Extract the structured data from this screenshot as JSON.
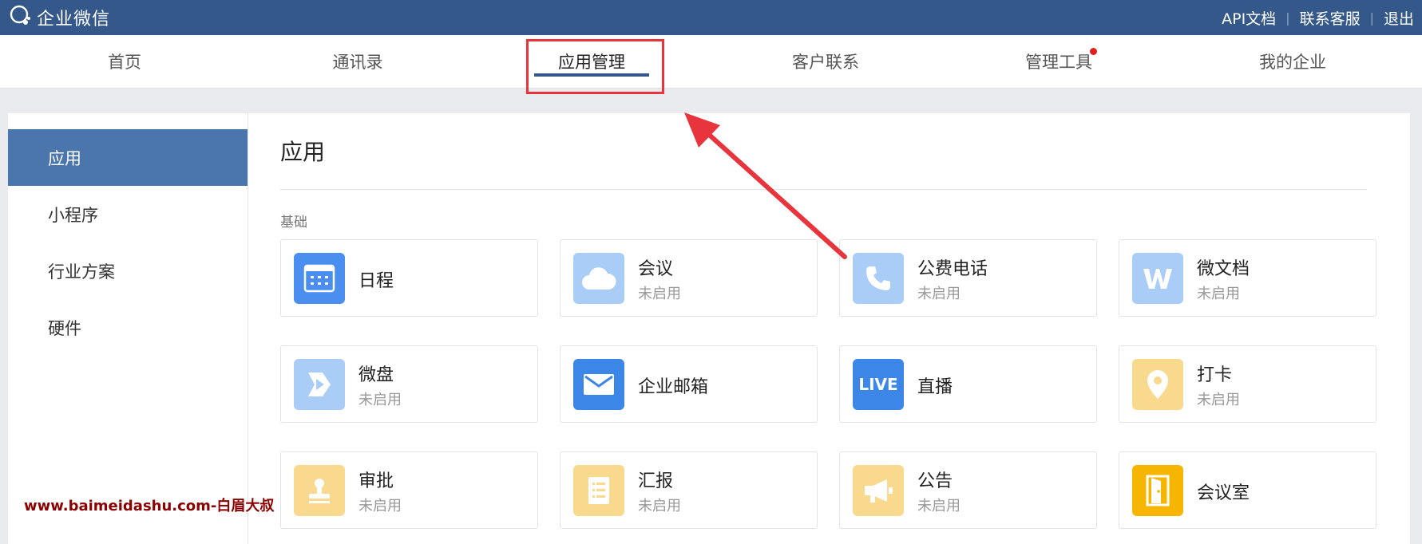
{
  "topbar": {
    "logo_text": "企业微信",
    "links": [
      "API文档",
      "联系客服",
      "退出"
    ]
  },
  "nav": {
    "tabs": [
      {
        "label": "首页"
      },
      {
        "label": "通讯录"
      },
      {
        "label": "应用管理",
        "active": true
      },
      {
        "label": "客户联系"
      },
      {
        "label": "管理工具",
        "badge": true
      },
      {
        "label": "我的企业"
      }
    ]
  },
  "sidebar": {
    "items": [
      {
        "label": "应用",
        "active": true
      },
      {
        "label": "小程序"
      },
      {
        "label": "行业方案"
      },
      {
        "label": "硬件"
      }
    ]
  },
  "main": {
    "title": "应用",
    "section": "基础",
    "apps": [
      {
        "name": "日程",
        "status": "",
        "icon": "calendar-icon",
        "color": "#4a8eef"
      },
      {
        "name": "会议",
        "status": "未启用",
        "icon": "cloud-icon",
        "color": "#a9cdf7"
      },
      {
        "name": "公费电话",
        "status": "未启用",
        "icon": "phone-icon",
        "color": "#a9cdf7"
      },
      {
        "name": "微文档",
        "status": "未启用",
        "icon": "w-doc-icon",
        "color": "#a9cdf7"
      },
      {
        "name": "微盘",
        "status": "未启用",
        "icon": "drive-icon",
        "color": "#a9cdf7"
      },
      {
        "name": "企业邮箱",
        "status": "",
        "icon": "mail-icon",
        "color": "#3b86e6"
      },
      {
        "name": "直播",
        "status": "",
        "icon": "live-icon",
        "color": "#3b86e6"
      },
      {
        "name": "打卡",
        "status": "未启用",
        "icon": "location-pin-icon",
        "color": "#f8d98e"
      },
      {
        "name": "审批",
        "status": "未启用",
        "icon": "stamp-icon",
        "color": "#f8d98e"
      },
      {
        "name": "汇报",
        "status": "未启用",
        "icon": "report-icon",
        "color": "#f8d98e"
      },
      {
        "name": "公告",
        "status": "未启用",
        "icon": "megaphone-icon",
        "color": "#f8d98e"
      },
      {
        "name": "会议室",
        "status": "",
        "icon": "door-icon",
        "color": "#f5b500"
      }
    ],
    "live_icon_text": "LIVE"
  },
  "watermark": "www.baimeidashu.com-白眉大叔",
  "colors": {
    "topbar": "#34588a",
    "accent": "#4a75ad",
    "highlight": "#e8343c"
  }
}
